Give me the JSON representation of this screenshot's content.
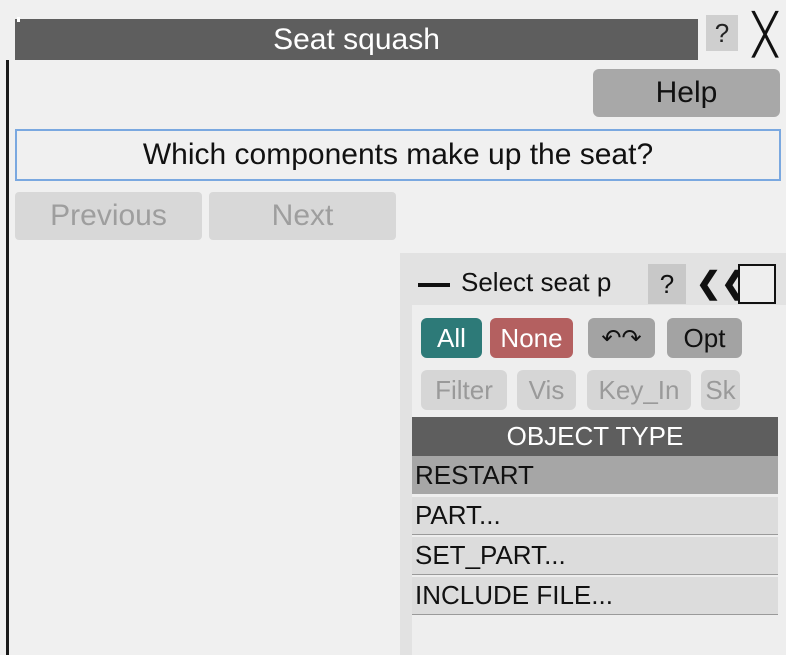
{
  "window": {
    "title": "Seat squash",
    "help_glyph": "?",
    "close_glyph": "╳"
  },
  "toolbar": {
    "help_label": "Help"
  },
  "prompt": {
    "question": "Which components make up the seat?"
  },
  "nav": {
    "previous_label": "Previous",
    "next_label": "Next"
  },
  "panel": {
    "title": "Select seat p",
    "help_glyph": "?",
    "collapse_glyph": "❮❮",
    "buttons": {
      "all": "All",
      "none": "None",
      "swap_glyph": "↶↷",
      "opt": "Opt"
    },
    "disabled_buttons": {
      "filter": "Filter",
      "vis": "Vis",
      "key_in": "Key_In",
      "sk": "Sk"
    },
    "object_type_header": "OBJECT TYPE",
    "object_types": [
      "RESTART",
      "PART...",
      "SET_PART...",
      "INCLUDE FILE..."
    ],
    "selected_index": 0
  },
  "colors": {
    "title_bar": "#5e5e5e",
    "all_button": "#2d7a78",
    "none_button": "#b46060",
    "question_border": "#7aa8e0"
  }
}
